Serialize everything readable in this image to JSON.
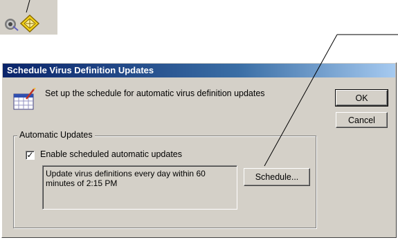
{
  "dialog": {
    "title": "Schedule Virus Definition Updates",
    "header_text": "Set up the schedule for automatic virus definition updates",
    "ok_label": "OK",
    "cancel_label": "Cancel",
    "group_title": "Automatic Updates",
    "checkbox": {
      "label": "Enable scheduled automatic updates",
      "checked": true,
      "mark": "✓"
    },
    "schedule_description": "Update virus definitions every day within 60 minutes of 2:15 PM",
    "schedule_button_label": "Schedule..."
  },
  "tray": {
    "icons": [
      "speaker-icon",
      "antivirus-shield-icon"
    ]
  },
  "colors": {
    "titlebar_start": "#0a246a",
    "titlebar_end": "#a6caf0",
    "face": "#d4d0c8"
  }
}
